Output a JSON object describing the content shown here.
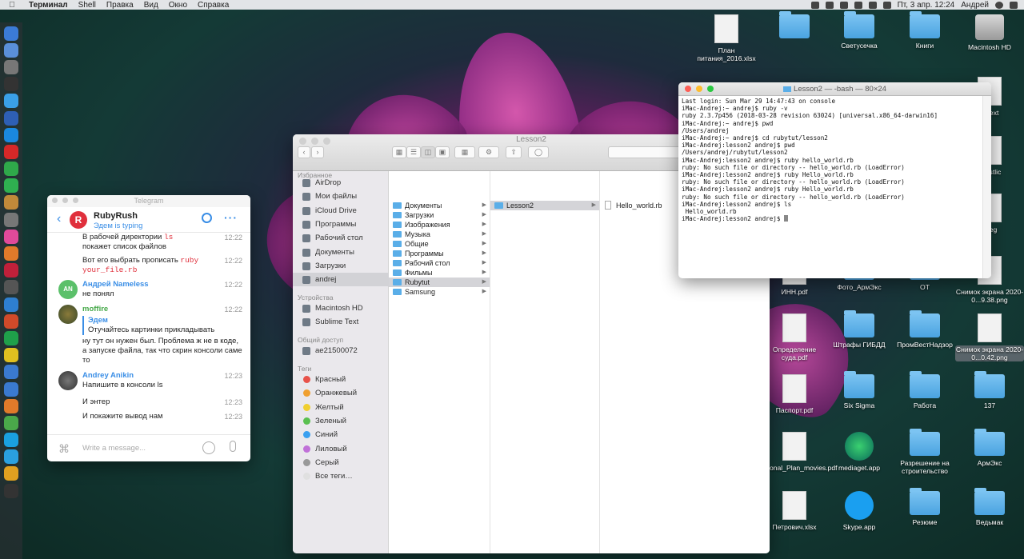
{
  "menubar": {
    "app_name": "Терминал",
    "items": [
      "Shell",
      "Правка",
      "Вид",
      "Окно",
      "Справка"
    ],
    "clock": "Пт, 3 апр.  12:24",
    "user": "Андрей"
  },
  "dock": {
    "icon_colors": [
      "#3b7bd6",
      "#5a8fd8",
      "#777",
      "#333",
      "#3aa0e8",
      "#2e5fb5",
      "#1a88e0",
      "#d62828",
      "#2fa84a",
      "#2fb050",
      "#c08a3a",
      "#777",
      "#e04a9a",
      "#e07a2a",
      "#c0203a",
      "#555",
      "#2e7fd0",
      "#d04a2a",
      "#1fa04a",
      "#e0c020",
      "#3a7ad0",
      "#3a7ad0",
      "#e07a2a",
      "#4aa84a",
      "#1aa0e0",
      "#2aa0e0",
      "#e0a020",
      "#333"
    ]
  },
  "telegram": {
    "title": "Telegram",
    "chat_name": "RubyRush",
    "chat_status": "Эдем is typing",
    "avatar_letter": "R",
    "input_placeholder": "Write a message...",
    "messages": [
      {
        "text1": "В рабочей директории ",
        "code1": "ls",
        "text2": "покажет список файлов",
        "time": "12:22"
      },
      {
        "text1": "Вот его выбрать прописать ",
        "code1": "ruby",
        "code2": "your_file.rb",
        "time": "12:22"
      },
      {
        "sender": "Андрей Nameless",
        "avatar": "AN",
        "text": "не понял",
        "time": "12:22"
      },
      {
        "sender": "moffire",
        "quote_name": "Эдем",
        "quote_text": "Отучайтесь картинки прикладывать",
        "text": "ну тут он нужен был. Проблема ж не в коде, а запуске файла, так что скрин консоли саме то",
        "time": "12:22"
      },
      {
        "sender": "Andrey Anikin",
        "text": "Напишите в консоли ls",
        "time": "12:23"
      },
      {
        "text": "И энтер",
        "time": "12:23"
      },
      {
        "text": "И покажите вывод нам",
        "time": "12:23"
      }
    ]
  },
  "finder": {
    "title": "Lesson2",
    "sidebar": {
      "favorites_label": "Избранное",
      "favorites": [
        "AirDrop",
        "Мои файлы",
        "iCloud Drive",
        "Программы",
        "Рабочий стол",
        "Документы",
        "Загрузки",
        "andrej"
      ],
      "devices_label": "Устройства",
      "devices": [
        "Macintosh HD",
        "Sublime Text"
      ],
      "shared_label": "Общий доступ",
      "shared": [
        "ae21500072"
      ],
      "tags_label": "Теги",
      "tags": [
        {
          "name": "Красный",
          "color": "#e8524a"
        },
        {
          "name": "Оранжевый",
          "color": "#f0a030"
        },
        {
          "name": "Желтый",
          "color": "#f0cf30"
        },
        {
          "name": "Зеленый",
          "color": "#5ac050"
        },
        {
          "name": "Синий",
          "color": "#3aa0f0"
        },
        {
          "name": "Лиловый",
          "color": "#c070d8"
        },
        {
          "name": "Серый",
          "color": "#999999"
        },
        {
          "name": "Все теги…",
          "color": "#e0e0e0"
        }
      ]
    },
    "column1": [
      "Документы",
      "Загрузки",
      "Изображения",
      "Музыка",
      "Общие",
      "Программы",
      "Рабочий стол",
      "Фильмы",
      "Rubytut",
      "Samsung"
    ],
    "column2": [
      "Lesson2"
    ],
    "column3": [
      "Hello_world.rb"
    ]
  },
  "terminal": {
    "title": "Lesson2 — -bash — 80×24",
    "lines": [
      "Last login: Sun Mar 29 14:47:43 on console",
      "iMac-Andrej:~ andrej$ ruby -v",
      "ruby 2.3.7p456 (2018-03-28 revision 63024) [universal.x86_64-darwin16]",
      "iMac-Andrej:~ andrej$ pwd",
      "/Users/andrej",
      "iMac-Andrej:~ andrej$ cd rubytut/lesson2",
      "iMac-Andrej:lesson2 andrej$ pwd",
      "/Users/andrej/rubytut/lesson2",
      "iMac-Andrej:lesson2 andrej$ ruby hello_world.rb",
      "ruby: No such file or directory -- hello_world.rb (LoadError)",
      "iMac-Andrej:lesson2 andrej$ ruby Hello_world.rb",
      "ruby: No such file or directory -- hello_world.rb (LoadError)",
      "iMac-Andrej:lesson2 andrej$ ruby Hello_world.rb",
      "ruby: No such file or directory -- hello_world.rb (LoadError)",
      "iMac-Andrej:lesson2 andrej$ ls",
      " Hello_world.rb",
      "iMac-Andrej:lesson2 andrej$ "
    ]
  },
  "desktop": {
    "icons": [
      {
        "label": "План питания_2016.xlsx",
        "kind": "doc"
      },
      {
        "label": "",
        "kind": "folder"
      },
      {
        "label": "Светусечка",
        "kind": "folder"
      },
      {
        "label": "Книги",
        "kind": "folder"
      },
      {
        "label": "Macintosh HD",
        "kind": "disk"
      },
      {
        "label": "e Text",
        "kind": "doc"
      },
      {
        "label": "avastlic",
        "kind": "doc"
      },
      {
        "label": ".jpeg",
        "kind": "doc"
      },
      {
        "label": "ИНН.pdf",
        "kind": "doc"
      },
      {
        "label": "Фото_АрмЭкс",
        "kind": "folder"
      },
      {
        "label": "ОТ",
        "kind": "folder"
      },
      {
        "label": "Снимок экрана 2020-0...9.38.png",
        "kind": "doc"
      },
      {
        "label": "Определение суда.pdf",
        "kind": "doc"
      },
      {
        "label": "Штрафы ГИБДД",
        "kind": "folder"
      },
      {
        "label": "ПромВестНадзор",
        "kind": "folder"
      },
      {
        "label": "Снимок экрана 2020-0...0.42.png",
        "kind": "doc"
      },
      {
        "label": "Паспорт.pdf",
        "kind": "doc"
      },
      {
        "label": "Six Sigma",
        "kind": "folder"
      },
      {
        "label": "Работа",
        "kind": "folder"
      },
      {
        "label": "137",
        "kind": "folder"
      },
      {
        "label": "ersonal_Plan_movies.pdf",
        "kind": "doc"
      },
      {
        "label": "mediaget.app",
        "kind": "app-green"
      },
      {
        "label": "Разрешение на строительство",
        "kind": "folder"
      },
      {
        "label": "АрмЭкс",
        "kind": "folder"
      },
      {
        "label": "Петрович.xlsx",
        "kind": "doc"
      },
      {
        "label": "Skype.app",
        "kind": "app-blue"
      },
      {
        "label": "Резюме",
        "kind": "folder"
      },
      {
        "label": "Ведьмак",
        "kind": "folder"
      }
    ]
  }
}
